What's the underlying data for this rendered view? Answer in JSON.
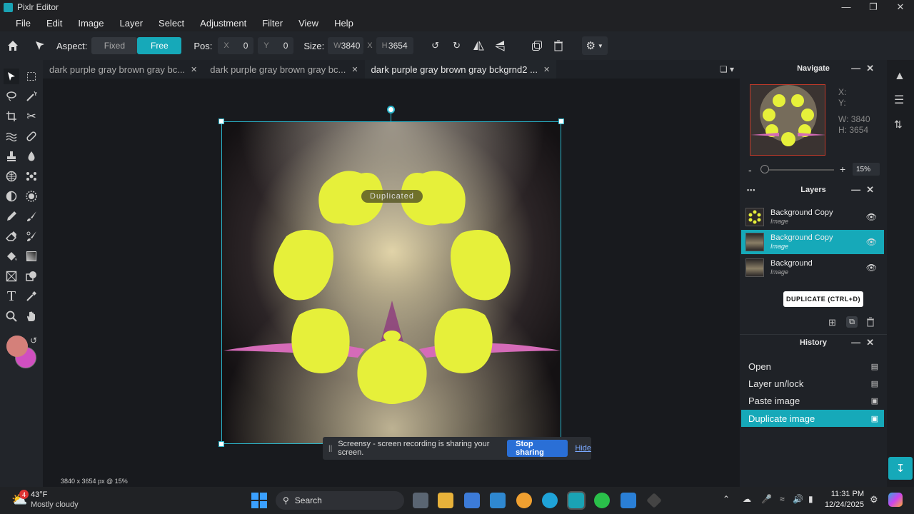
{
  "window": {
    "title": "Pixlr Editor"
  },
  "menu": [
    "File",
    "Edit",
    "Image",
    "Layer",
    "Select",
    "Adjustment",
    "Filter",
    "View",
    "Help"
  ],
  "toolbar": {
    "aspect_label": "Aspect:",
    "fixed_label": "Fixed",
    "free_label": "Free",
    "pos_label": "Pos:",
    "pos_x_key": "X",
    "pos_x": "0",
    "pos_y_key": "Y",
    "pos_y": "0",
    "size_label": "Size:",
    "size_w_key": "W",
    "size_w": "3840",
    "size_x_sep": "X",
    "size_h_key": "H",
    "size_h": "3654"
  },
  "tabs": [
    {
      "label": "dark purple gray brown gray bc..."
    },
    {
      "label": "dark purple gray brown gray bc..."
    },
    {
      "label": "dark purple gray brown gray bckgrnd2 ..."
    }
  ],
  "canvas": {
    "toast": "Duplicated"
  },
  "status": {
    "info": "3840 x 3654 px @ 15%"
  },
  "share_bar": {
    "pause": "||",
    "text": "Screensy - screen recording is sharing your screen.",
    "stop": "Stop sharing",
    "hide": "Hide"
  },
  "navigate": {
    "title": "Navigate",
    "x_label": "X:",
    "y_label": "Y:",
    "w_label": "W:",
    "w_value": "3840",
    "h_label": "H:",
    "h_value": "3654",
    "zoom_minus": "-",
    "zoom_plus": "+",
    "zoom": "15%",
    "zoom_fraction": 0.03
  },
  "layers": {
    "title": "Layers",
    "more": "•••",
    "items": [
      {
        "name": "Background Copy",
        "type": "Image",
        "selected": false
      },
      {
        "name": "Background Copy",
        "type": "Image",
        "selected": true
      },
      {
        "name": "Background",
        "type": "Image",
        "selected": false
      }
    ],
    "tooltip": "DUPLICATE (CTRL+D)"
  },
  "history": {
    "title": "History",
    "items": [
      {
        "label": "Open",
        "selected": false
      },
      {
        "label": "Layer un/lock",
        "selected": false
      },
      {
        "label": "Paste image",
        "selected": false
      },
      {
        "label": "Duplicate image",
        "selected": true
      }
    ]
  },
  "taskbar": {
    "weather_badge": "4",
    "temp": "43°F",
    "weather": "Mostly cloudy",
    "search": "Search",
    "time": "11:31 PM",
    "date": "12/24/2025"
  },
  "colors": {
    "accent": "#16a9b9",
    "primary_swatch": "#d4807a",
    "secondary_swatch": "#d04fc0",
    "yellow": "#e6f03a"
  }
}
